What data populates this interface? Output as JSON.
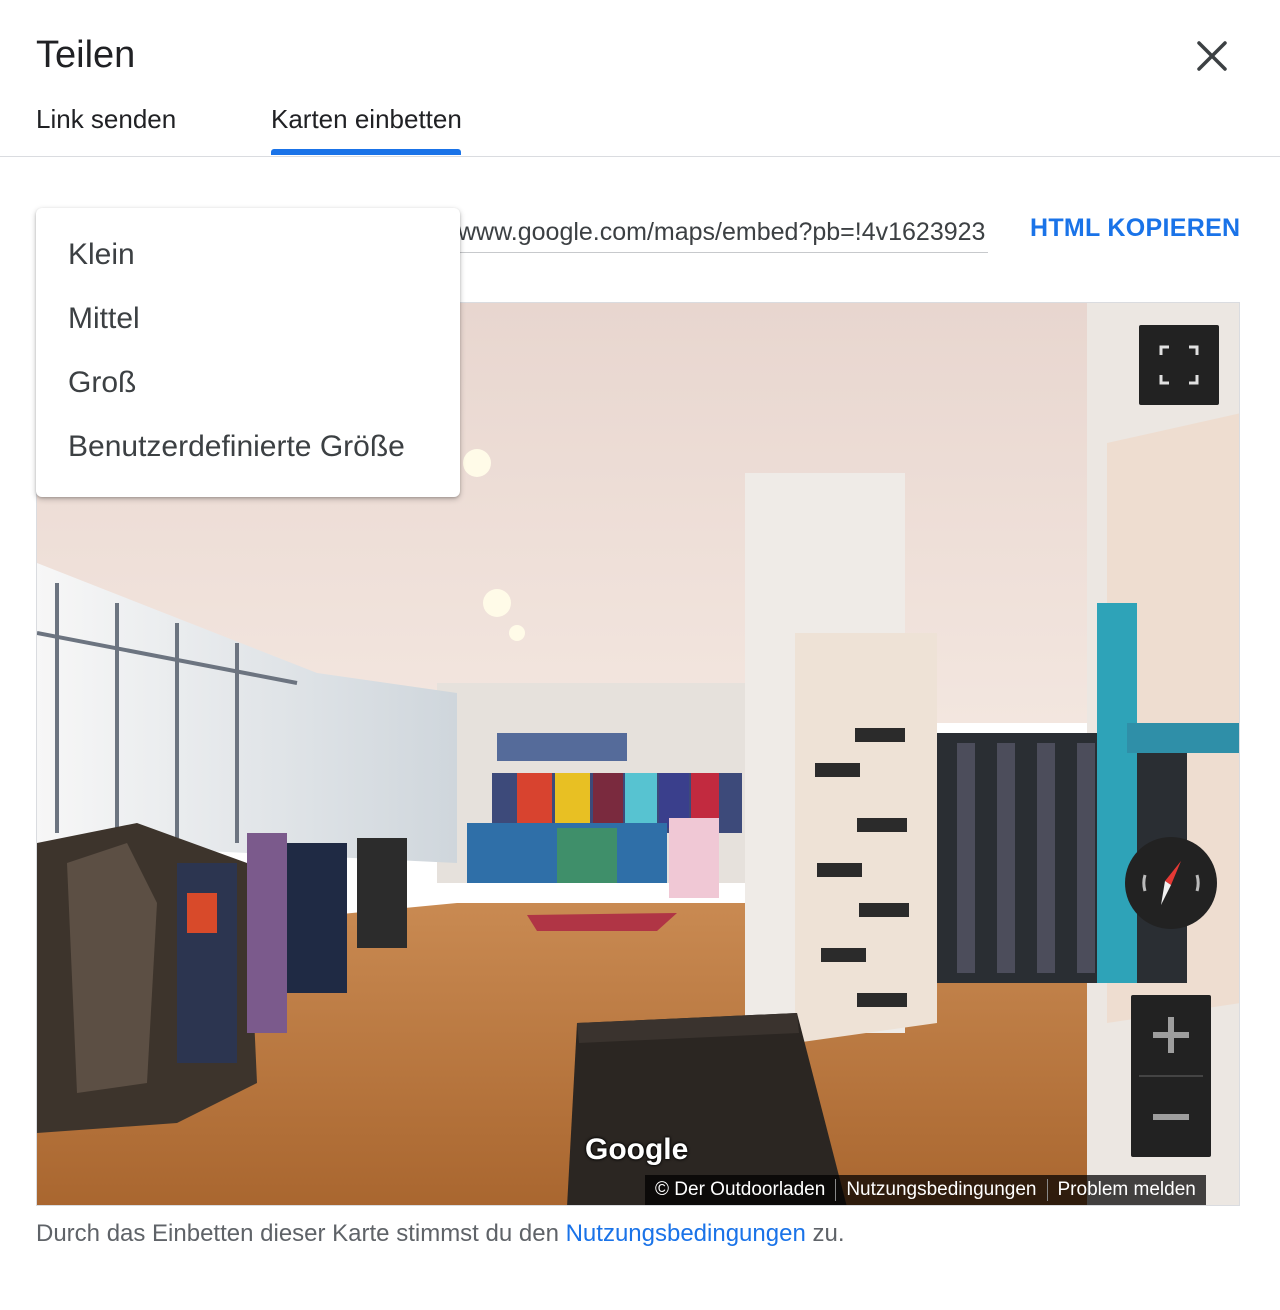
{
  "dialog": {
    "title": "Teilen",
    "close_icon": "close-icon"
  },
  "tabs": [
    {
      "label": "Link senden",
      "selected": false
    },
    {
      "label": "Karten einbetten",
      "selected": true
    }
  ],
  "embed": {
    "url_value": "www.google.com/maps/embed?pb=!4v1623923",
    "copy_label": "HTML KOPIEREN"
  },
  "size_menu": {
    "options": [
      "Klein",
      "Mittel",
      "Groß",
      "Benutzerdefinierte Größe"
    ]
  },
  "map": {
    "logo": "Google",
    "attribution": {
      "owner": "© Der Outdoorladen",
      "terms": "Nutzungsbedingungen",
      "report": "Problem melden"
    },
    "controls": [
      "fullscreen-icon",
      "compass-icon",
      "zoom-in-icon",
      "zoom-out-icon"
    ]
  },
  "footer": {
    "text_before": "Durch das Einbetten dieser Karte stimmst du den ",
    "link": "Nutzungsbedingungen",
    "text_after": " zu."
  },
  "colors": {
    "accent": "#1a73e8",
    "text": "#202124",
    "muted": "#5f6368"
  }
}
